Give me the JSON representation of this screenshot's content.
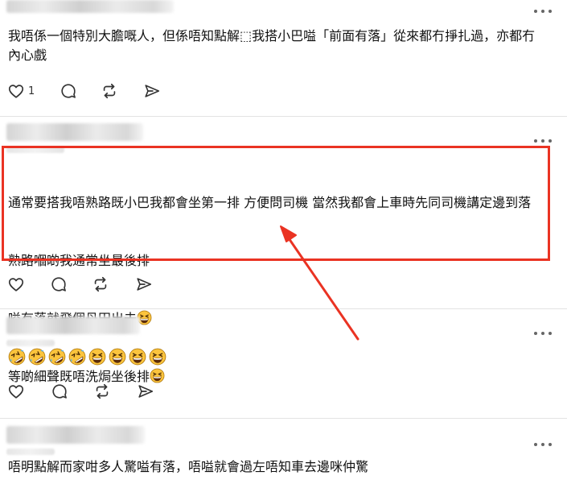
{
  "posts": [
    {
      "text": "我唔係一個特別大膽嘅人，但係唔知點解⬚我搭小巴嗌「前面有落」從來都冇掙扎過，亦都冇內心戲",
      "likes": "1"
    },
    {
      "lines": [
        "通常要搭我唔熟路既小巴我都會坐第一排 方便問司機 當然我都會上車時先同司機講定邊到落",
        "熟路嗰啲我通常坐最後排",
        "嗌有落就飛個丹田出去",
        "等啲細聲既唔洗焗坐後排"
      ]
    },
    {
      "emojis": [
        "rolling-on-floor-laughing",
        "rolling-on-floor-laughing",
        "rolling-on-floor-laughing",
        "rolling-on-floor-laughing",
        "grinning-squinting",
        "grinning-squinting",
        "grinning-squinting",
        "grinning-squinting"
      ]
    },
    {
      "text": "唔明點解而家咁多人驚嗌有落，唔嗌就會過左唔知車去邊咪仲驚"
    }
  ],
  "annotation": {
    "color": "#ea3323"
  },
  "icons": [
    "like-icon",
    "comment-icon",
    "repost-icon",
    "share-icon",
    "more-icon"
  ]
}
